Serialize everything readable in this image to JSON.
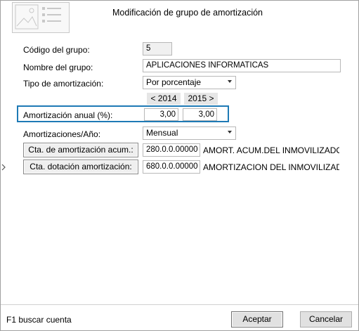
{
  "dialog": {
    "title": "Modificación de grupo de amortización"
  },
  "form": {
    "codigo_label": "Código del grupo:",
    "codigo_value": "5",
    "nombre_label": "Nombre del grupo:",
    "nombre_value": "APLICACIONES INFORMATICAS",
    "tipo_label": "Tipo de amortización:",
    "tipo_value": "Por porcentaje",
    "prev_year": "< 2014",
    "next_year": "2015 >",
    "anual_label": "Amortización anual (%):",
    "anual_value_1": "3,00",
    "anual_value_2": "3,00",
    "periodo_label": "Amortizaciones/Año:",
    "periodo_value": "Mensual",
    "cta_acum_button": "Cta. de amortización acum.:",
    "cta_acum_code": "280.0.0.00000",
    "cta_acum_desc": "AMORT. ACUM.DEL INMOVILIZADO IN",
    "cta_dot_button": "Cta. dotación amortización:",
    "cta_dot_code": "680.0.0.00000",
    "cta_dot_desc": "AMORTIZACION DEL INMOVILIZADO I"
  },
  "footer": {
    "hint": "F1 buscar cuenta",
    "accept": "Aceptar",
    "cancel": "Cancelar"
  },
  "icons": {
    "header": "form-card-icon",
    "side": "chevron-right-icon",
    "dropdown": "chevron-down-icon"
  },
  "colors": {
    "highlight_border": "#1e7ab5"
  }
}
